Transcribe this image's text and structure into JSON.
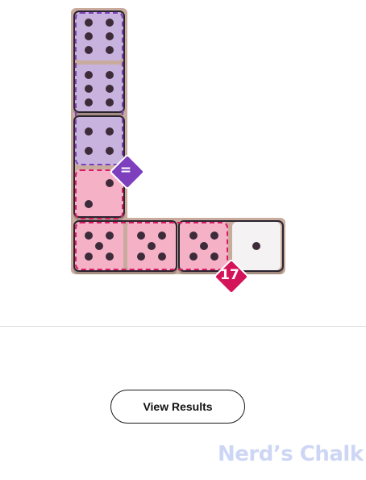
{
  "board": {
    "cells": [
      {
        "row": 0,
        "col": 0,
        "pips": 6,
        "color": "purple"
      },
      {
        "row": 1,
        "col": 0,
        "pips": 6,
        "color": "purple"
      },
      {
        "row": 2,
        "col": 0,
        "pips": 4,
        "color": "purple"
      },
      {
        "row": 3,
        "col": 0,
        "pips": 2,
        "color": "pink"
      },
      {
        "row": 4,
        "col": 0,
        "pips": 5,
        "color": "pink"
      },
      {
        "row": 4,
        "col": 1,
        "pips": 5,
        "color": "pink"
      },
      {
        "row": 4,
        "col": 2,
        "pips": 5,
        "color": "pink"
      },
      {
        "row": 4,
        "col": 3,
        "pips": 1,
        "color": "white"
      }
    ],
    "badges": [
      {
        "label": "=",
        "color": "#7e3fbf",
        "name": "equal-condition-badge"
      },
      {
        "label": "17",
        "color": "#d4145a",
        "name": "sum-17-condition-badge"
      }
    ]
  },
  "actions": {
    "view_results": "View Results"
  },
  "watermark": "Nerd’s Chalk"
}
